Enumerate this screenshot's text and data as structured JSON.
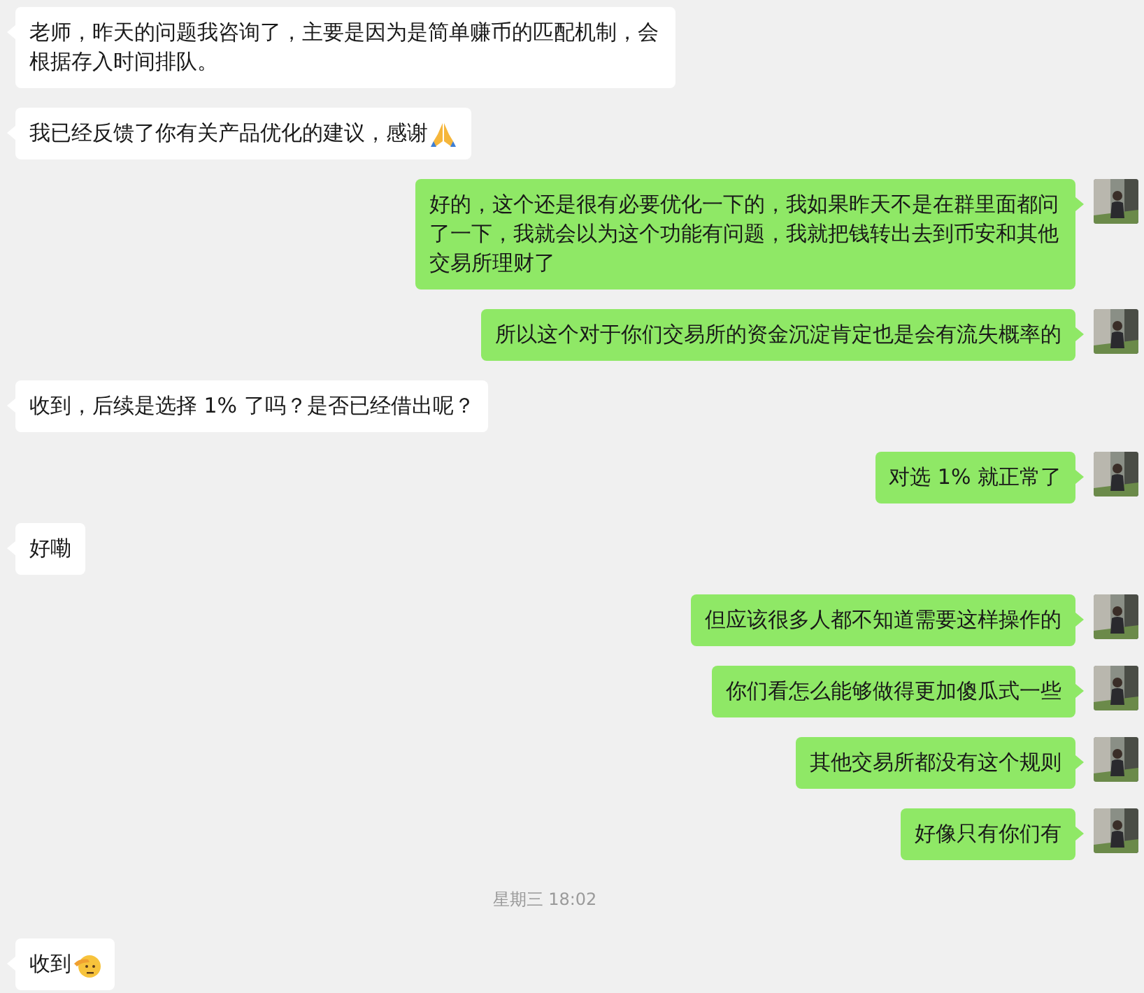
{
  "messages": [
    {
      "kind": "in",
      "text": "老师，昨天的问题我咨询了，主要是因为是简单赚币的匹配机制，会根据存入时间排队。"
    },
    {
      "kind": "in",
      "text": "我已经反馈了你有关产品优化的建议，感谢",
      "trailing_icon": {
        "kind": "pray"
      }
    },
    {
      "kind": "out",
      "text": "好的，这个还是很有必要优化一下的，我如果昨天不是在群里面都问了一下，我就会以为这个功能有问题，我就把钱转出去到币安和其他交易所理财了"
    },
    {
      "kind": "out",
      "text": "所以这个对于你们交易所的资金沉淀肯定也是会有流失概率的"
    },
    {
      "kind": "in",
      "text": "收到，后续是选择 1% 了吗？是否已经借出呢？"
    },
    {
      "kind": "out",
      "text": "对选 1% 就正常了"
    },
    {
      "kind": "in",
      "text": "好嘞"
    },
    {
      "kind": "out",
      "text": "但应该很多人都不知道需要这样操作的"
    },
    {
      "kind": "out",
      "text": "你们看怎么能够做得更加傻瓜式一些"
    },
    {
      "kind": "out",
      "text": "其他交易所都没有这个规则"
    },
    {
      "kind": "out",
      "text": "好像只有你们有"
    },
    {
      "kind": "time",
      "text": "星期三 18:02"
    },
    {
      "kind": "in",
      "text": "收到",
      "trailing_icon": {
        "kind": "salute"
      }
    }
  ]
}
